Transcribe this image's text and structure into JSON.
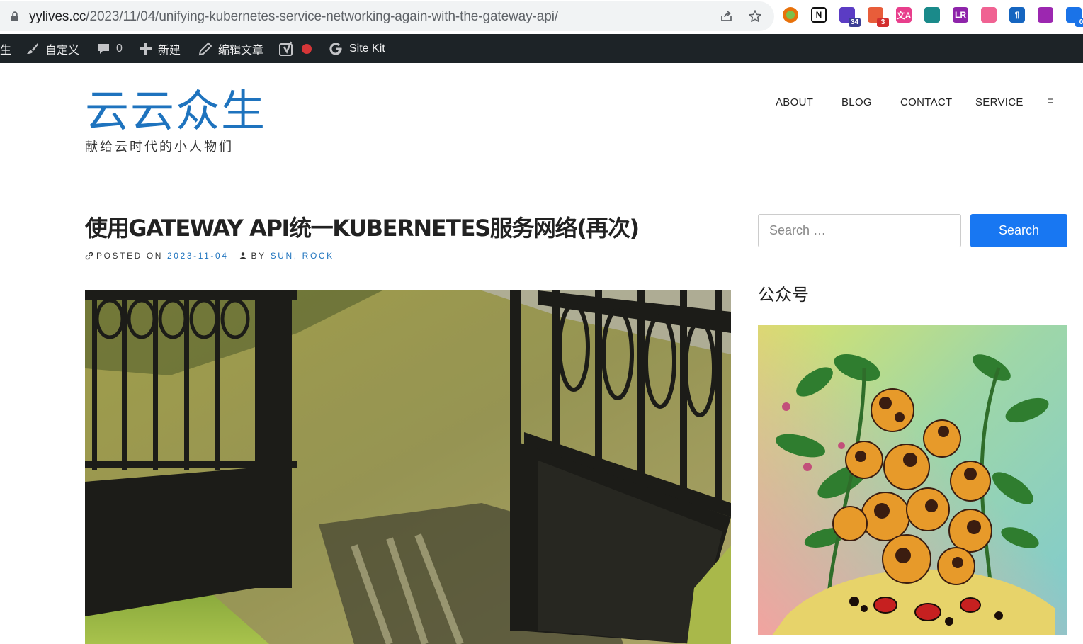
{
  "browser": {
    "url_host": "yylives.cc",
    "url_path": "/2023/11/04/unifying-kubernetes-service-networking-again-with-the-gateway-api/",
    "icons": [
      "lock-icon",
      "share-icon",
      "star-icon"
    ],
    "extensions": [
      {
        "name": "ext-green-circle-icon",
        "color": "#e8710a",
        "label": "",
        "badge": ""
      },
      {
        "name": "ext-notion-icon",
        "color": "#ffffff",
        "label": "N",
        "badge": ""
      },
      {
        "name": "ext-graduation-icon",
        "color": "#5b3cc4",
        "label": "",
        "badge": "34"
      },
      {
        "name": "ext-cookie-icon",
        "color": "#e85d3a",
        "label": "",
        "badge": "3"
      },
      {
        "name": "ext-translate-icon",
        "color": "#e83e8c",
        "label": "文A",
        "badge": ""
      },
      {
        "name": "ext-grid-icon",
        "color": "#1a8a8a",
        "label": "",
        "badge": ""
      },
      {
        "name": "ext-lr-icon",
        "color": "#8e24aa",
        "label": "LR",
        "badge": ""
      },
      {
        "name": "ext-cloud-icon",
        "color": "#f06292",
        "label": "",
        "badge": ""
      },
      {
        "name": "ext-pilcrow-icon",
        "color": "#1565c0",
        "label": "¶",
        "badge": ""
      },
      {
        "name": "ext-openai-icon",
        "color": "#9c27b0",
        "label": "",
        "badge": ""
      },
      {
        "name": "ext-refresh-icon",
        "color": "#1a73e8",
        "label": "",
        "badge": "0"
      }
    ]
  },
  "admin_bar": {
    "site_fragment": "生",
    "customize": "自定义",
    "comments_count": "0",
    "new": "新建",
    "edit_post": "编辑文章",
    "site_kit": "Site Kit"
  },
  "site": {
    "title": "云云众生",
    "description": "献给云时代的小人物们"
  },
  "nav": {
    "items": [
      "ABOUT",
      "BLOG",
      "CONTACT",
      "SERVICE"
    ],
    "menu_glyph": "≡"
  },
  "post": {
    "title": "使用GATEWAY API统一KUBERNETES服务网络(再次)",
    "posted_on_label": "POSTED ON",
    "date": "2023-11-04",
    "by_label": "BY",
    "author": "SUN, ROCK"
  },
  "sidebar": {
    "search_placeholder": "Search …",
    "search_button": "Search",
    "widget_title": "公众号"
  },
  "colors": {
    "link": "#1e73be",
    "button": "#1877f2",
    "admin_bar": "#1d2327"
  }
}
